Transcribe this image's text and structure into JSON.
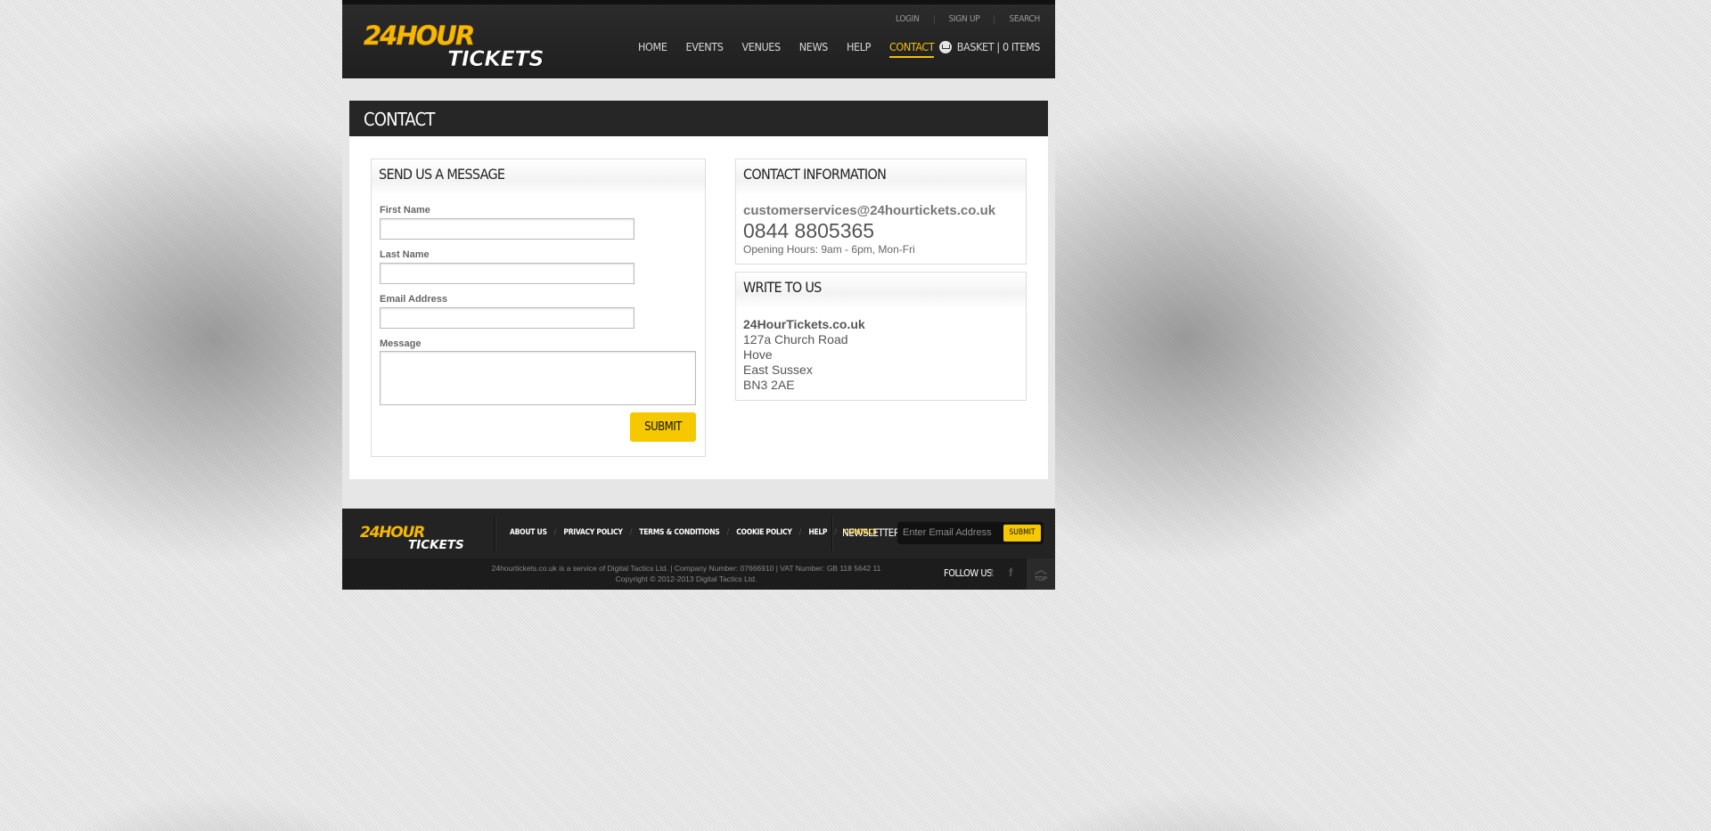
{
  "header": {
    "logo_top": "24HOUR",
    "logo_bottom": "TICKETS",
    "top_links": [
      "LOGIN",
      "SIGN UP",
      "SEARCH"
    ],
    "nav": [
      "HOME",
      "EVENTS",
      "VENUES",
      "NEWS",
      "HELP",
      "CONTACT"
    ],
    "active_nav": "CONTACT",
    "basket": "BASKET | 0 ITEMS"
  },
  "page": {
    "title": "CONTACT"
  },
  "form": {
    "title": "SEND US A MESSAGE",
    "first_name_label": "First Name",
    "last_name_label": "Last Name",
    "email_label": "Email Address",
    "message_label": "Message",
    "first_name_value": "",
    "last_name_value": "",
    "email_value": "",
    "message_value": "",
    "submit": "SUBMIT"
  },
  "contact_info": {
    "title": "CONTACT INFORMATION",
    "email": "customerservices@24hourtickets.co.uk",
    "phone": "0844 8805365",
    "hours": "Opening Hours: 9am - 6pm, Mon-Fri"
  },
  "write_to_us": {
    "title": "WRITE TO US",
    "company": "24HourTickets.co.uk",
    "line1": "127a Church Road",
    "line2": "Hove",
    "line3": "East Sussex",
    "line4": "BN3 2AE"
  },
  "footer": {
    "nav": [
      "ABOUT US",
      "PRIVACY POLICY",
      "TERMS & CONDITIONS",
      "COOKIE POLICY",
      "HELP",
      "CONTACT"
    ],
    "newsletter_label": "NEWSLETTER",
    "newsletter_placeholder": "Enter Email Address",
    "newsletter_submit": "SUBMIT",
    "legal": "24hourtickets.co.uk is a service of Digital Tactics Ltd. | Company Number: 07666910 | VAT Number: GB 118 5642 11",
    "copyright": "Copyright © 2012-2013 Digital Tactics Ltd.",
    "follow_us": "FOLLOW US",
    "top": "TOP"
  },
  "colors": {
    "accent": "#f6c000",
    "header_bg": "#232323"
  }
}
